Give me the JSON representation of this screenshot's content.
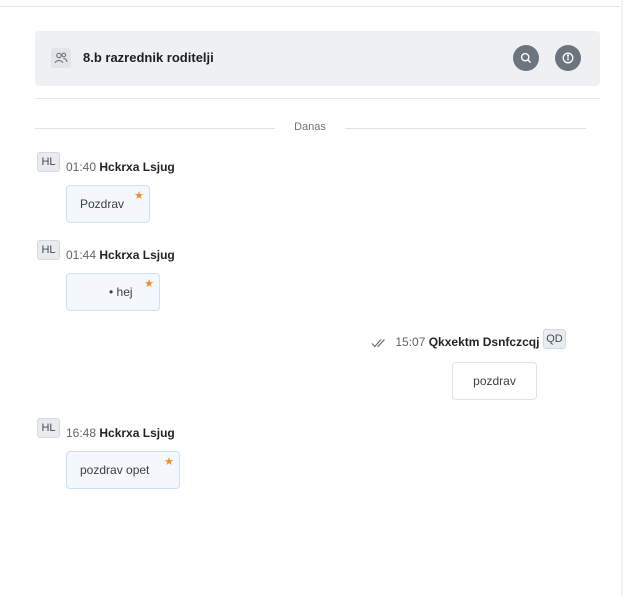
{
  "header": {
    "title": "8.b razrednik roditelji",
    "group_icon": "people-icon",
    "search_icon": "search-icon",
    "info_icon": "info-icon"
  },
  "date_separator": "Danas",
  "messages": [
    {
      "initials": "HL",
      "time": "01:40",
      "author": "Hckrxa Lsjug",
      "text": "Pozdrav",
      "starred": true,
      "own": false
    },
    {
      "initials": "HL",
      "time": "01:44",
      "author": "Hckrxa Lsjug",
      "text": "• hej",
      "starred": true,
      "own": false
    },
    {
      "initials": "QD",
      "time": "15:07",
      "author": "Qkxektm Dsnfczcqj",
      "text": "pozdrav",
      "starred": false,
      "own": true,
      "status_icon": "double-check-icon"
    },
    {
      "initials": "HL",
      "time": "16:48",
      "author": "Hckrxa Lsjug",
      "text": "pozdrav opet",
      "starred": true,
      "own": false
    }
  ],
  "colors": {
    "star": "#f28c28",
    "header_bg": "#eef0f2",
    "icon_button_bg": "#6c757d",
    "bubble_bg": "#f4f7fc",
    "bubble_border": "#cfdff5"
  }
}
